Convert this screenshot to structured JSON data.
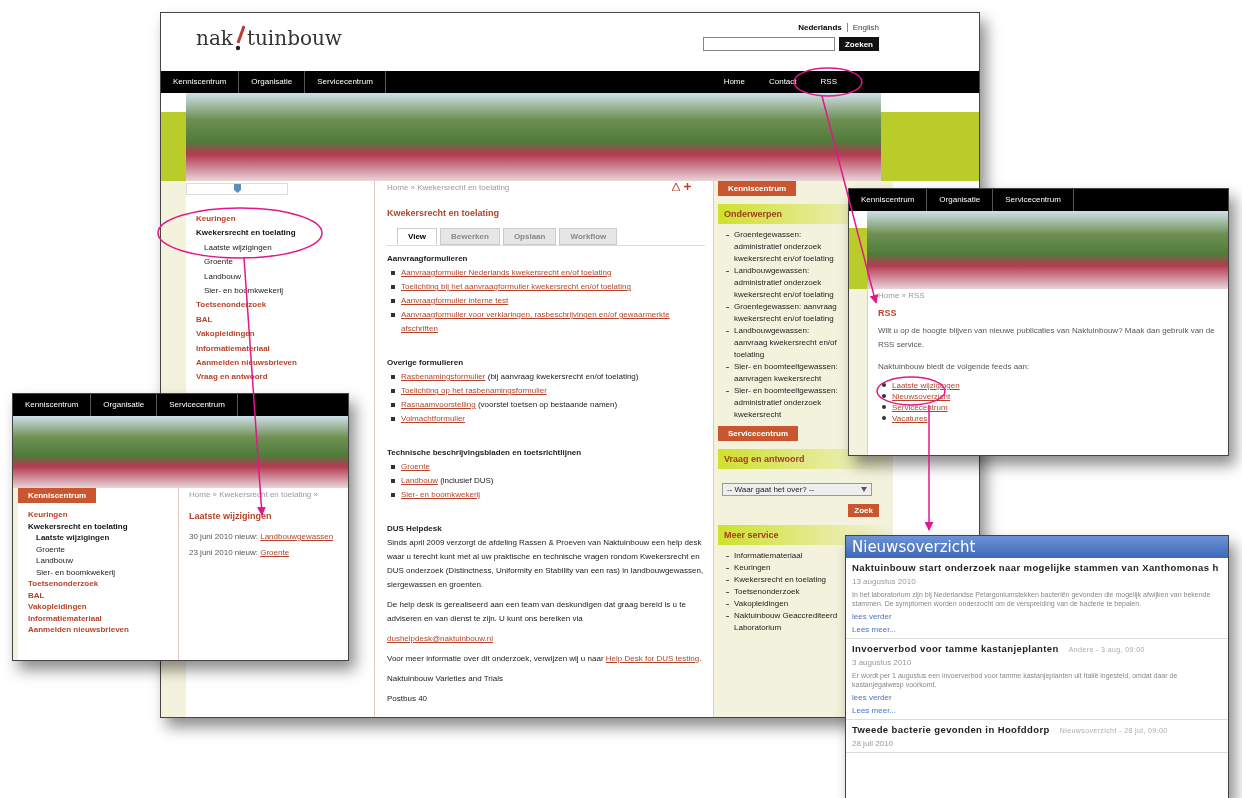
{
  "main_window": {
    "logo": {
      "left": "nak",
      "right": "tuinbouw"
    },
    "languages": [
      {
        "label": "Nederlands",
        "selected": true
      },
      {
        "label": "English",
        "selected": false
      }
    ],
    "search": {
      "button": "Zoeken"
    },
    "nav_left": [
      "Kenniscentrum",
      "Organisatie",
      "Servicecentrum"
    ],
    "nav_right": [
      "Home",
      "Contact",
      "RSS"
    ],
    "sidebar": [
      {
        "label": "Keuringen",
        "selected": false
      },
      {
        "label": "Kwekersrecht en toelating",
        "selected": true,
        "children": [
          {
            "label": "Laatste wijzigingen",
            "selected": false
          },
          {
            "label": "Groente",
            "selected": false
          },
          {
            "label": "Landbouw",
            "selected": false
          },
          {
            "label": "Sier- en boomkwekerij",
            "selected": false
          }
        ]
      },
      {
        "label": "Toetsenonderzoek",
        "selected": false
      },
      {
        "label": "BAL",
        "selected": false
      },
      {
        "label": "Vakopleidingen",
        "selected": false
      },
      {
        "label": "Informatiemateriaal",
        "selected": false
      },
      {
        "label": "Aanmelden nieuwsbrieven",
        "selected": false
      },
      {
        "label": "Vraag en antwoord",
        "selected": false
      }
    ],
    "breadcrumb": "Home » Kwekersrecht en toelating",
    "title": "Kwekersrecht en toelating",
    "tabs": [
      {
        "label": "View",
        "selected": true
      },
      {
        "label": "Bewerken",
        "selected": false
      },
      {
        "label": "Opslaan",
        "selected": false
      },
      {
        "label": "Workflow",
        "selected": false
      }
    ],
    "sections": [
      {
        "heading": "Aanvraagformulieren",
        "items": [
          {
            "link": "Aanvraagformulier Nederlands kwekersrecht en/of toelating"
          },
          {
            "link": "Toelichting bij het aanvraagformulier kwekersrecht en/of toelating"
          },
          {
            "link": "Aanvraagformulier interne test"
          },
          {
            "link": "Aanvraagformulier voor verklaringen, rasbeschrijvingen en/of gewaarmerkte afschriften"
          }
        ]
      },
      {
        "heading": "Overige formulieren",
        "items": [
          {
            "link": "Rasbenamingsformulier",
            "note": "(bij aanvraag kwekersrecht en/of toelating)"
          },
          {
            "link": "Toelichting op het rasbenamingsformulier"
          },
          {
            "link": "Rasnaamvoorstelling",
            "note": "(voorstel toetsen op bestaande namen)"
          },
          {
            "link": "Volmachtformulier"
          }
        ]
      },
      {
        "heading": "Technische beschrijvingsbladen en toetsrichtlijnen",
        "items": [
          {
            "link": "Groente"
          },
          {
            "link": "Landbouw",
            "note": "(inclusief DUS)"
          },
          {
            "link": "Sier- en boomkwekerij"
          }
        ]
      }
    ],
    "helpdesk": {
      "heading": "DUS Helpdesk",
      "paragraphs": [
        "Sinds april 2009 verzorgt de afdeling Rassen & Proeven van Naktuinbouw een help desk waar u terecht kunt met al uw praktische en technische vragen rondom Kwekersrecht en DUS onderzoek (Distinctness, Uniformity en Stability van een ras) in landbouwgewassen, siergewassen en groenten.",
        "De help desk is gerealiseerd aan een team van deskundigen dat graag bereid is u te adviseren en van dienst te zijn. U kunt ons bereiken via"
      ],
      "email": "dushelpdesk@naktuinbouw.nl",
      "more_text": "Voor meer informatie over dit onderzoek, verwijzen wij u naar",
      "more_link": "Help Desk for DUS testing",
      "more_end": ".",
      "address": [
        "Naktuinbouw Varieties and Trials",
        "Postbus 40"
      ]
    },
    "right": {
      "button_top": "Kenniscentrum",
      "topics_heading": "Onderwerpen",
      "topics": [
        "Groentegewassen: administratief onderzoek kwekersrecht en/of toelating",
        "Landbouwgewassen: administratief onderzoek kwekersrecht en/of toelating",
        "Groentegewassen: aanvraag kwekersrecht en/of toelating",
        "Landbouwgewassen: aanvraag kwekersrecht en/of toelating",
        "Sier- en boomteeltgewassen: aanvragen kwekersrecht",
        "Sier- en boomteeltgewassen: administratief onderzoek kwekersrecht"
      ],
      "button_service": "Servicecentrum",
      "qa_heading": "Vraag en antwoord",
      "qa_select": "-- Waar gaat het over? --",
      "qa_button": "Zoek",
      "service_heading": "Meer service",
      "service": [
        "Informatiemateriaal",
        "Keuringen",
        "Kwekersrecht en toelating",
        "Toetsenonderzoek",
        "Vakopleidingen",
        "Naktuinbouw Geaccrediteerd Laboratorium"
      ]
    }
  },
  "inset_changes": {
    "nav": [
      "Kenniscentrum",
      "Organisatie",
      "Servicecentrum"
    ],
    "button": "Kenniscentrum",
    "sidebar": [
      {
        "label": "Keuringen",
        "selected": false
      },
      {
        "label": "Kwekersrecht en toelating",
        "selected": true,
        "children": [
          {
            "label": "Laatste wijzigingen",
            "selected": true
          },
          {
            "label": "Groente",
            "selected": false
          },
          {
            "label": "Landbouw",
            "selected": false
          },
          {
            "label": "Sier- en boomkwekerij",
            "selected": false
          }
        ]
      },
      {
        "label": "Toetsenonderzoek",
        "selected": false
      },
      {
        "label": "BAL",
        "selected": false
      },
      {
        "label": "Vakopleidingen",
        "selected": false
      },
      {
        "label": "Informatiemateriaal",
        "selected": false
      },
      {
        "label": "Aanmelden nieuwsbrieven",
        "selected": false
      }
    ],
    "breadcrumb": "Home » Kwekersrecht en toelating »",
    "title": "Laatste wijzigingen",
    "entries": [
      {
        "text": "30 juni 2010 nieuw:",
        "link": "Landbouwgewassen"
      },
      {
        "text": "23 juni 2010 nieuw:",
        "link": "Groente"
      }
    ]
  },
  "inset_rss": {
    "nav": [
      "Kenniscentrum",
      "Organisatie",
      "Servicecentrum"
    ],
    "breadcrumb": "Home » RSS",
    "title": "RSS",
    "intro": "Wilt u op de hoogte blijven van nieuwe publicaties van Naktuinbouw? Maak dan gebruik van de RSS service.",
    "feeds_intro": "Naktuinbouw biedt de volgende feeds aan:",
    "feeds": [
      "Laatste wijzigingen",
      "Nieuwsoverzicht",
      "Servicecentrum",
      "Vacatures"
    ]
  },
  "inset_news": {
    "title": "Nieuwsoverzicht",
    "items": [
      {
        "headline": "Naktuinbouw start onderzoek naar mogelijke stammen van Xanthomonas h",
        "date": "13 augustus 2010",
        "text": "In het laboratorium zijn bij Nederlandse Pelargoniumstekken bacteriën gevonden die mogelijk afwijken van bekende stammen. De symptomen worden onderzocht om de verspreiding van de bacterie te bepalen.",
        "links": [
          "lees verder",
          "Lees meer..."
        ]
      },
      {
        "headline": "Invoerverbod voor tamme kastanjeplanten",
        "meta": "Andere - 3 aug, 09:00",
        "date": "3 augustus 2010",
        "text": "Er wordt per 1 augustus een invoerverbod voor tamme kastanjeplanten uit Italië ingesteld, omdat daar de kastanjegalwesp voorkomt.",
        "links": [
          "lees verder",
          "Lees meer..."
        ]
      },
      {
        "headline": "Tweede bacterie gevonden in Hoofddorp",
        "meta": "Nieuwsoverzicht - 28 jul, 09:00",
        "date": "28 juli 2010"
      }
    ]
  }
}
